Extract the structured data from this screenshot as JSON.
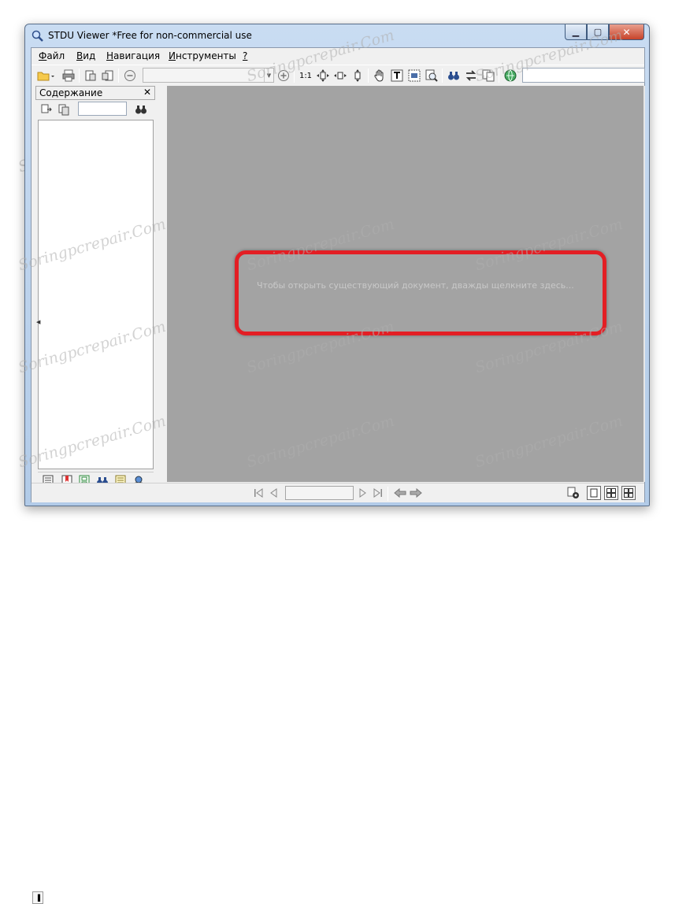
{
  "window": {
    "title": "STDU Viewer *Free for non-commercial use",
    "controls": {
      "minimize": "▁",
      "maximize": "▢",
      "close": "✕"
    }
  },
  "menu": [
    {
      "key": "Ф",
      "rest": "айл"
    },
    {
      "key": "В",
      "rest": "ид"
    },
    {
      "key": "Н",
      "rest": "авигация"
    },
    {
      "key": "И",
      "rest": "нструменты"
    },
    {
      "key": "?",
      "rest": ""
    }
  ],
  "toolbar": {
    "zoom_value": "",
    "search_value": "",
    "icons": [
      "open-folder-icon",
      "print-icon",
      "export-text-icon",
      "export-image-icon",
      "zoom-out-icon",
      "zoom-in-icon",
      "actual-size-icon",
      "fit-page-icon",
      "fit-width-icon",
      "fit-height-icon",
      "hand-tool-icon",
      "select-text-icon",
      "select-image-icon",
      "magnify-icon",
      "find-icon",
      "swap-icon",
      "copy-icon",
      "web-icon"
    ]
  },
  "sidebar": {
    "title": "Содержание",
    "close": "✕",
    "search_value": ""
  },
  "document": {
    "hint": "Чтобы открыть существующий документ, дважды щелкните здесь...",
    "highlight_color": "#e31e24"
  },
  "statusbar": {
    "page_value": ""
  },
  "watermark": "Soringpcrepair.Com",
  "colors": {
    "doc_background": "#a3a3a3",
    "chrome": "#f0f0f0"
  }
}
